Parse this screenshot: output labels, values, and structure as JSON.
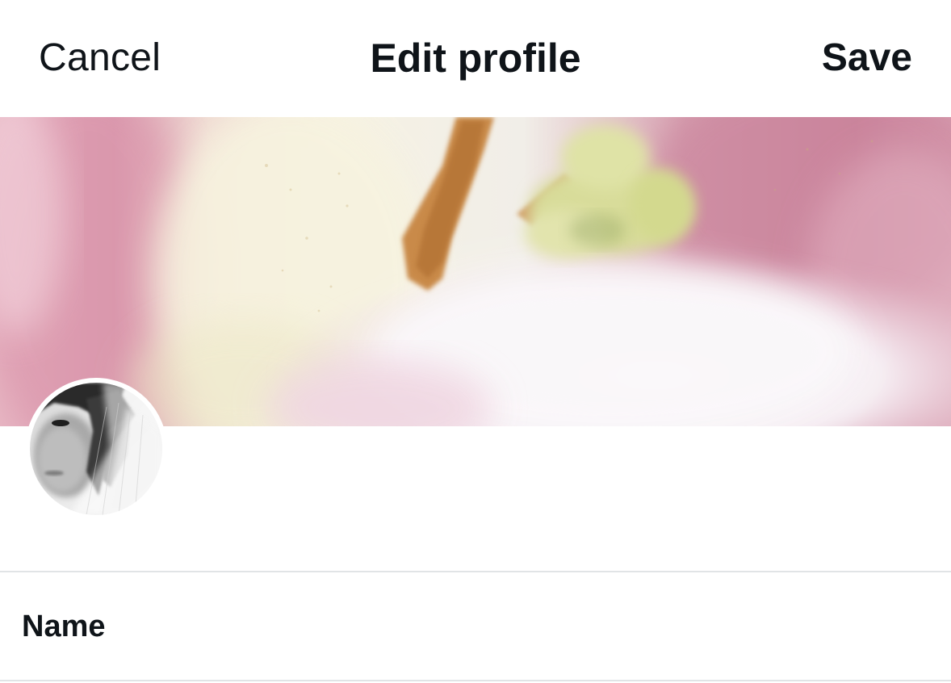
{
  "navbar": {
    "cancel_label": "Cancel",
    "title": "Edit profile",
    "save_label": "Save"
  },
  "form": {
    "fields": [
      {
        "label": "Name",
        "value": ""
      }
    ]
  },
  "colors": {
    "text": "#0f1419",
    "background": "#ffffff",
    "divider": "#e1e4e6"
  }
}
